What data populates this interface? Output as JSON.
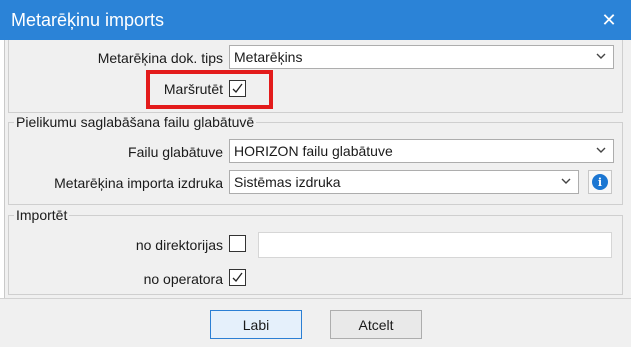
{
  "window": {
    "title": "Metarēķinu imports",
    "close_glyph": "✕"
  },
  "form": {
    "doc_type_label": "Metarēķina dok. tips",
    "doc_type_value": "Metarēķins",
    "route_label": "Maršrutēt",
    "route_checked": true
  },
  "attachments": {
    "group_title": "Pielikumu saglabāšana failu glabātuvē",
    "storage_label": "Failu glabātuve",
    "storage_value": "HORIZON failu glabātuve",
    "printout_label": "Metarēķina importa izdruka",
    "printout_value": "Sistēmas izdruka",
    "info_glyph": "i"
  },
  "import": {
    "group_title": "Importēt",
    "from_directory_label": "no direktorijas",
    "from_directory_checked": false,
    "directory_path_value": "",
    "from_operator_label": "no operatora",
    "from_operator_checked": true
  },
  "buttons": {
    "ok_label": "Labi",
    "cancel_label": "Atcelt"
  },
  "icons": {
    "close": "close-icon",
    "dropdown": "chevron-down-icon",
    "info": "info-icon",
    "check": "checkmark-icon"
  },
  "colors": {
    "titlebar": "#2b83d7",
    "highlight": "#e31b1b",
    "info": "#1b76d2"
  }
}
